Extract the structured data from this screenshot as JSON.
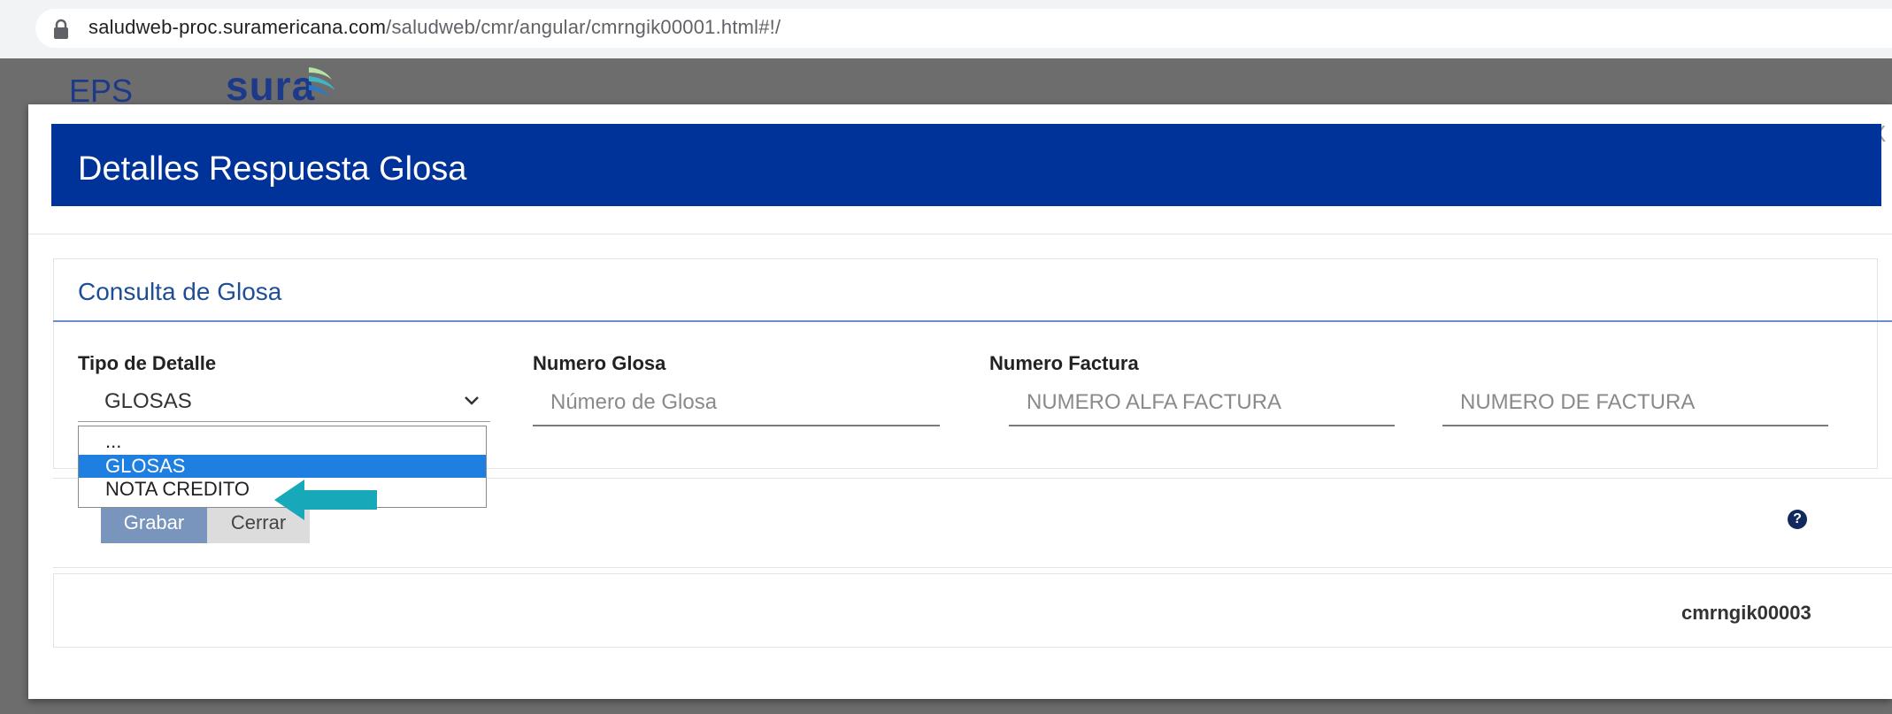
{
  "browser": {
    "url_host": "saludweb-proc.suramericana.com",
    "url_path": "/saludweb/cmr/angular/cmrngik00001.html#!/"
  },
  "brand": {
    "eps_label": "EPS",
    "logo_text": "sura"
  },
  "modal": {
    "title": "Detalles Respuesta Glosa",
    "close_label": "X"
  },
  "panel": {
    "title": "Consulta de Glosa",
    "fields": {
      "tipo_detalle_label": "Tipo de Detalle",
      "tipo_detalle_value": "GLOSAS",
      "numero_glosa_label": "Numero Glosa",
      "numero_glosa_placeholder": "Número de Glosa",
      "numero_factura_label": "Numero Factura",
      "alfa_factura_placeholder": "NUMERO ALFA FACTURA",
      "numero_factura_placeholder": "NUMERO DE FACTURA"
    },
    "dropdown_options": [
      "...",
      "GLOSAS",
      "NOTA CREDITO"
    ],
    "dropdown_selected": "GLOSAS"
  },
  "actions": {
    "save_label": "Grabar",
    "close_label": "Cerrar",
    "help_icon": "question-circle-icon"
  },
  "footer": {
    "page_code": "cmrngik00003"
  },
  "colors": {
    "header_blue": "#003399",
    "arrow_teal": "#17a9b9",
    "selected_option": "#1e7fe0"
  }
}
